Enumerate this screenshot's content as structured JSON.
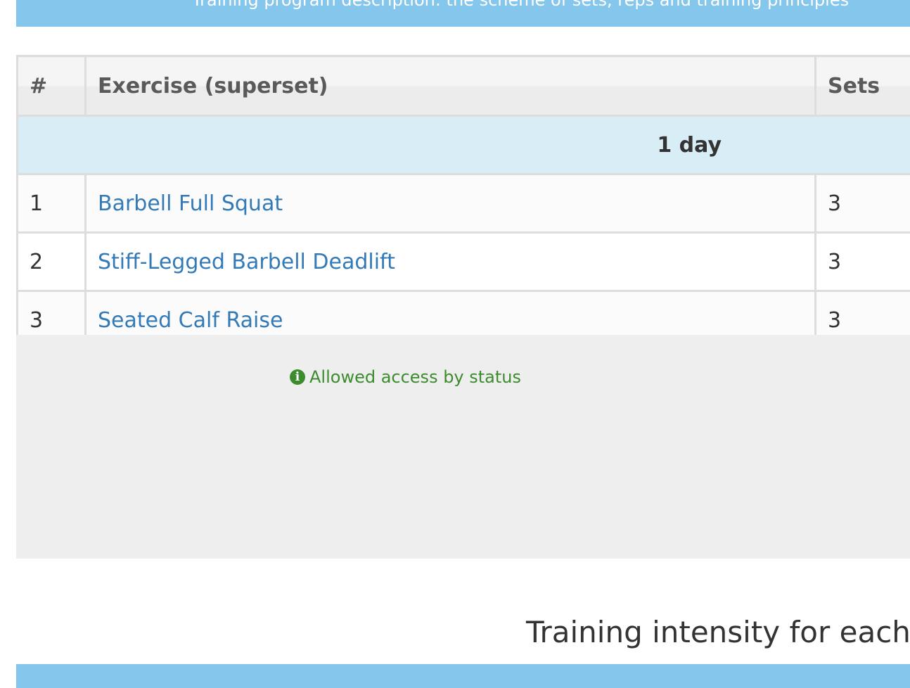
{
  "top_banner": {
    "text": "Training program description: the scheme of sets, reps and training principles"
  },
  "table": {
    "headers": {
      "num": "#",
      "exercise": "Exercise (superset)",
      "sets": "Sets"
    },
    "day_label": "1 day",
    "rows": [
      {
        "num": "1",
        "exercise": "Barbell Full Squat",
        "sets": "3"
      },
      {
        "num": "2",
        "exercise": "Stiff-Legged Barbell Deadlift",
        "sets": "3"
      },
      {
        "num": "3",
        "exercise": "Seated Calf Raise",
        "sets": "3"
      }
    ]
  },
  "access_note": {
    "icon": "info-circle-icon",
    "text": "Allowed access by status"
  },
  "section": {
    "title": "Training intensity for each"
  },
  "colors": {
    "banner": "#85c6ec",
    "day_row": "#d9edf7",
    "link": "#337ab7",
    "access_note": "#3c8c2e",
    "overlay": "#eeeeee"
  }
}
